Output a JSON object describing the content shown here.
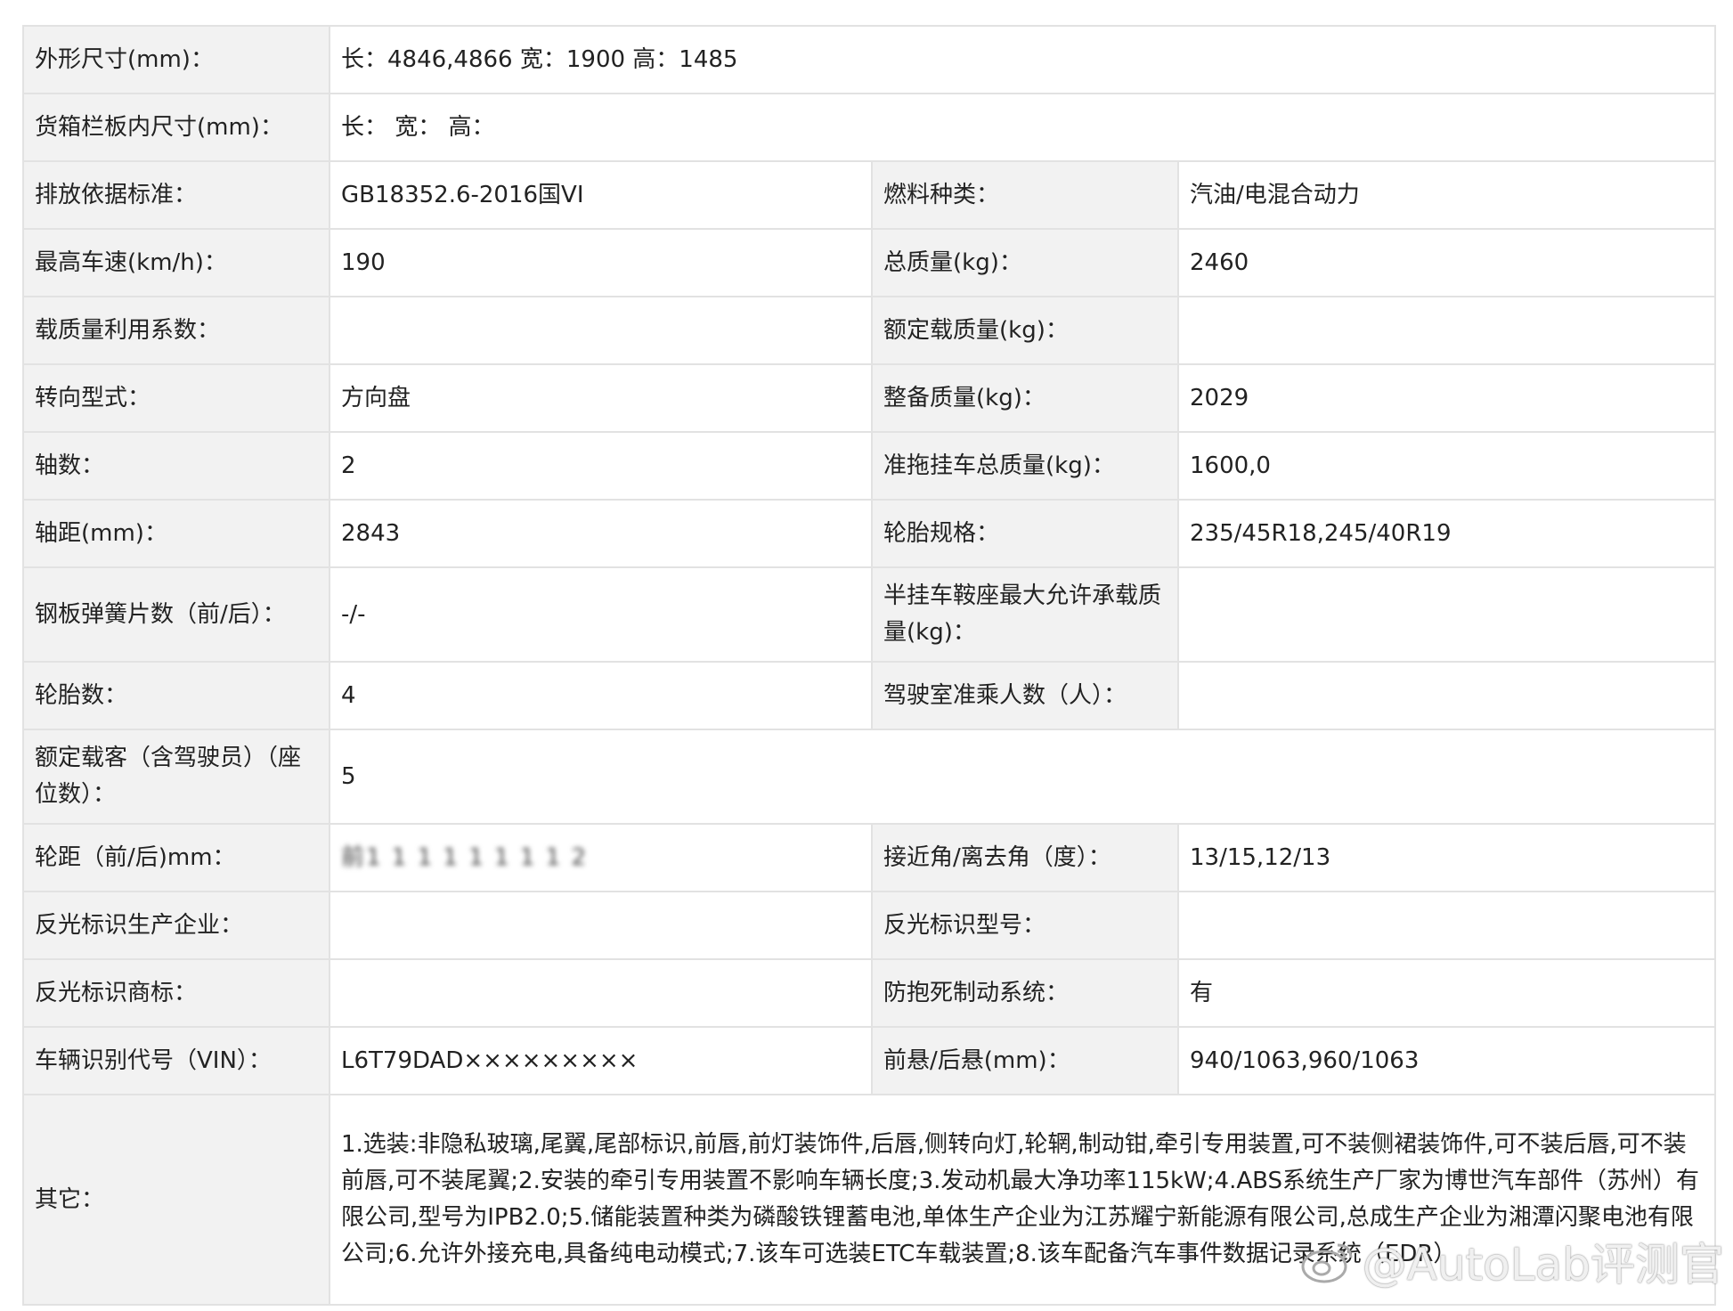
{
  "rows": {
    "r0": {
      "l1": "外形尺寸(mm)：",
      "v1": "长：4846,4866 宽：1900 高：1485"
    },
    "r1": {
      "l1": "货箱栏板内尺寸(mm)：",
      "v1": "长： 宽： 高："
    },
    "r2": {
      "l1": "排放依据标准：",
      "v1": "GB18352.6-2016国VI",
      "l2": "燃料种类：",
      "v2": "汽油/电混合动力"
    },
    "r3": {
      "l1": "最高车速(km/h)：",
      "v1": "190",
      "l2": "总质量(kg)：",
      "v2": "2460"
    },
    "r4": {
      "l1": "载质量利用系数：",
      "v1": "",
      "l2": "额定载质量(kg)：",
      "v2": ""
    },
    "r5": {
      "l1": "转向型式：",
      "v1": "方向盘",
      "l2": "整备质量(kg)：",
      "v2": "2029"
    },
    "r6": {
      "l1": "轴数：",
      "v1": "2",
      "l2": "准拖挂车总质量(kg)：",
      "v2": "1600,0"
    },
    "r7": {
      "l1": "轴距(mm)：",
      "v1": "2843",
      "l2": "轮胎规格：",
      "v2": "235/45R18,245/40R19"
    },
    "r8": {
      "l1": "钢板弹簧片数（前/后）：",
      "v1": "-/-",
      "l2": "半挂车鞍座最大允许承载质量(kg)：",
      "v2": ""
    },
    "r9": {
      "l1": "轮胎数：",
      "v1": "4",
      "l2": "驾驶室准乘人数（人）：",
      "v2": ""
    },
    "r10": {
      "l1": "额定载客（含驾驶员）（座位数）：",
      "v1": "5"
    },
    "r11": {
      "l1": "轮距（前/后)mm：",
      "v1": "前1 1 1 1 1 1 1 1 2",
      "l2": "接近角/离去角（度）：",
      "v2": "13/15,12/13"
    },
    "r12": {
      "l1": "反光标识生产企业：",
      "v1": "",
      "l2": "反光标识型号：",
      "v2": ""
    },
    "r13": {
      "l1": "反光标识商标：",
      "v1": "",
      "l2": "防抱死制动系统：",
      "v2": "有"
    },
    "r14": {
      "l1": "车辆识别代号（VIN）：",
      "v1": "L6T79DAD×××××××××",
      "l2": "前悬/后悬(mm)：",
      "v2": "940/1063,960/1063"
    },
    "r15": {
      "l1": "其它：",
      "v1": "1.选装:非隐私玻璃,尾翼,尾部标识,前唇,前灯装饰件,后唇,侧转向灯,轮辋,制动钳,牵引专用装置,可不装侧裙装饰件,可不装后唇,可不装前唇,可不装尾翼;2.安装的牵引专用装置不影响车辆长度;3.发动机最大净功率115kW;4.ABS系统生产厂家为博世汽车部件（苏州）有限公司,型号为IPB2.0;5.储能装置种类为磷酸铁锂蓄电池,单体生产企业为江苏耀宁新能源有限公司,总成生产企业为湘潭闪聚电池有限公司;6.允许外接充电,具备纯电动模式;7.该车可选装ETC车载装置;8.该车配备汽车事件数据记录系统（EDR）."
    }
  },
  "watermark": {
    "text": "@AutoLab评测官",
    "icon": "weibo-icon"
  }
}
